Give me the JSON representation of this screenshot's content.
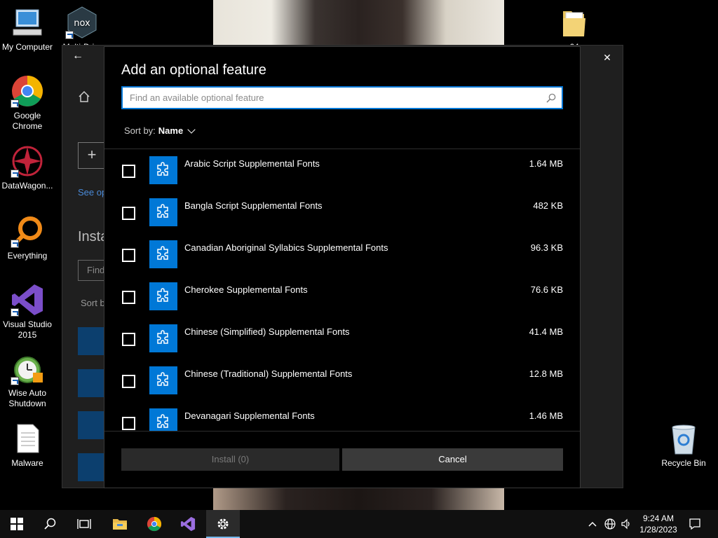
{
  "desktop": {
    "icons": [
      {
        "label": "My Computer"
      },
      {
        "label": "Multi-Dri..."
      },
      {
        "label": "Google Chrome"
      },
      {
        "label": "DataWagon..."
      },
      {
        "label": "Everything"
      },
      {
        "label": "Visual Studio 2015"
      },
      {
        "label": "Wise Auto Shutdown"
      },
      {
        "label": "Malware"
      },
      {
        "label": "64"
      },
      {
        "label": "Recycle Bin"
      }
    ]
  },
  "settings_window": {
    "back_glyph": "←",
    "minimize_glyph": "—",
    "maximize_glyph": "☐",
    "close_glyph": "✕",
    "add_glyph": "+",
    "link_text": "See op",
    "installed_heading": "Insta",
    "find_placeholder": "Find",
    "sort_text": "Sort b"
  },
  "dialog": {
    "title": "Add an optional feature",
    "search_placeholder": "Find an available optional feature",
    "sort_label": "Sort by:",
    "sort_value": "Name",
    "features": [
      {
        "name": "Arabic Script Supplemental Fonts",
        "size": "1.64 MB"
      },
      {
        "name": "Bangla Script Supplemental Fonts",
        "size": "482 KB"
      },
      {
        "name": "Canadian Aboriginal Syllabics Supplemental Fonts",
        "size": "96.3 KB"
      },
      {
        "name": "Cherokee Supplemental Fonts",
        "size": "76.6 KB"
      },
      {
        "name": "Chinese (Simplified) Supplemental Fonts",
        "size": "41.4 MB"
      },
      {
        "name": "Chinese (Traditional) Supplemental Fonts",
        "size": "12.8 MB"
      },
      {
        "name": "Devanagari Supplemental Fonts",
        "size": "1.46 MB"
      }
    ],
    "install_label": "Install (0)",
    "cancel_label": "Cancel"
  },
  "taskbar": {
    "time": "9:24 AM",
    "date": "1/28/2023"
  },
  "colors": {
    "accent": "#0078d7",
    "dialog_bg": "#000000",
    "taskbar_bg": "#101010"
  }
}
